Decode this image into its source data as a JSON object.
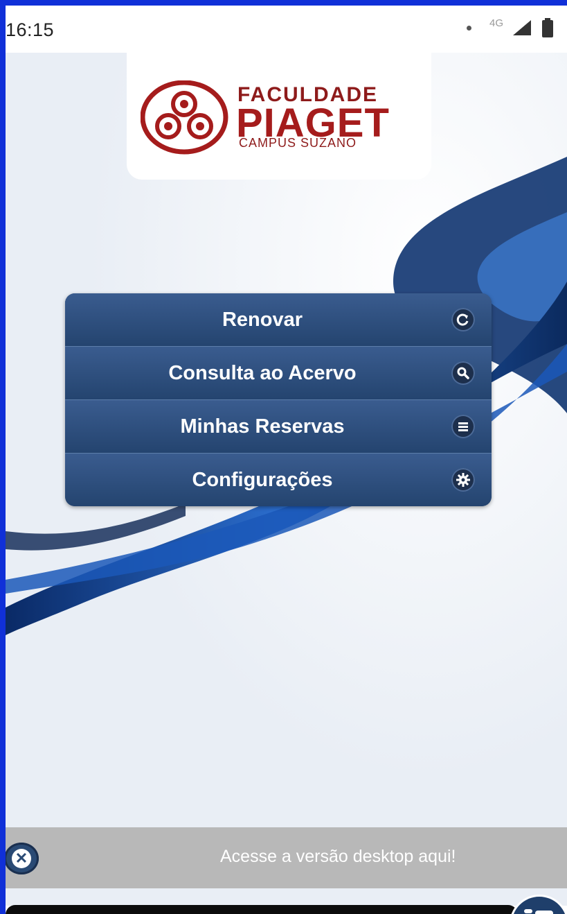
{
  "status_bar": {
    "time": "16:15",
    "network": "4G",
    "icons": [
      "notification-dot",
      "signal-icon",
      "battery-icon"
    ]
  },
  "logo": {
    "line1": "FACULDADE",
    "line2": "PIAGET",
    "line3": "CAMPUS SUZANO",
    "color": "#a51c1c"
  },
  "menu": {
    "items": [
      {
        "label": "Renovar",
        "icon": "refresh-icon"
      },
      {
        "label": "Consulta ao Acervo",
        "icon": "search-icon"
      },
      {
        "label": "Minhas Reservas",
        "icon": "list-icon"
      },
      {
        "label": "Configurações",
        "icon": "gear-icon"
      }
    ],
    "color": "#2d4d7c"
  },
  "banner": {
    "text": "Acesse a versão desktop aqui!",
    "close_icon": "close-icon"
  }
}
